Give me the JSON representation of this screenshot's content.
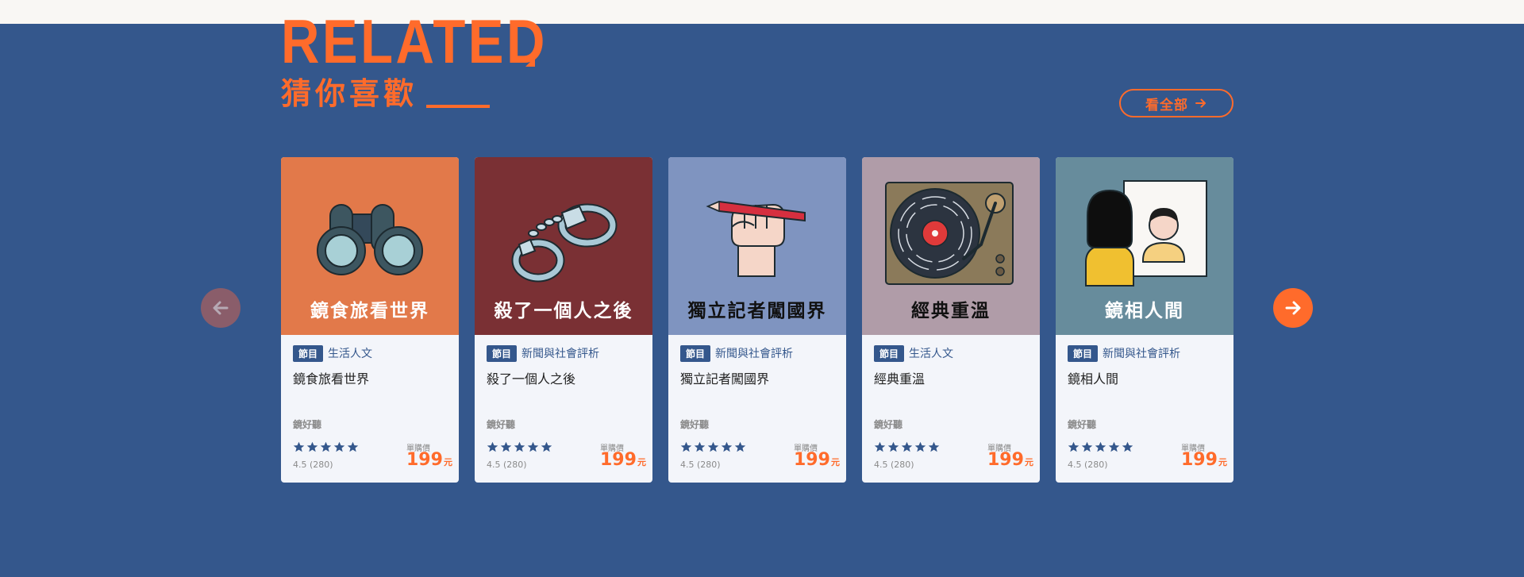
{
  "header": {
    "related": "RELATED",
    "title": "猜你喜歡",
    "see_all": "看全部"
  },
  "nav": {
    "prev_icon": "arrow-left-icon",
    "next_icon": "arrow-right-icon"
  },
  "colors": {
    "background": "#34578c",
    "accent": "#ff6b2b",
    "card_bg": "#f3f5fa"
  },
  "cards": [
    {
      "cover_title": "鏡食旅看世界",
      "cover_color": "#e2794a",
      "illustration": "binoculars",
      "tag": "節目",
      "category": "生活人文",
      "title": "鏡食旅看世界",
      "vendor": "鏡好聽",
      "rating": "4.5 (280)",
      "stars": 5,
      "price_label": "單購價",
      "price": "199",
      "unit": "元"
    },
    {
      "cover_title": "殺了一個人之後",
      "cover_color": "#7a3034",
      "illustration": "handcuffs",
      "tag": "節目",
      "category": "新聞與社會評析",
      "title": "殺了一個人之後",
      "vendor": "鏡好聽",
      "rating": "4.5 (280)",
      "stars": 5,
      "price_label": "單購價",
      "price": "199",
      "unit": "元"
    },
    {
      "cover_title": "獨立記者闖國界",
      "cover_color": "#7f94c0",
      "illustration": "fist-pencil",
      "tag": "節目",
      "category": "新聞與社會評析",
      "title": "獨立記者闖國界",
      "vendor": "鏡好聽",
      "rating": "4.5 (280)",
      "stars": 5,
      "price_label": "單購價",
      "price": "199",
      "unit": "元"
    },
    {
      "cover_title": "經典重溫",
      "cover_color": "#b09ca8",
      "illustration": "turntable",
      "tag": "節目",
      "category": "生活人文",
      "title": "經典重溫",
      "vendor": "鏡好聽",
      "rating": "4.5 (280)",
      "stars": 5,
      "price_label": "單購價",
      "price": "199",
      "unit": "元"
    },
    {
      "cover_title": "鏡相人間",
      "cover_color": "#678c9c",
      "illustration": "mirror-person",
      "tag": "節目",
      "category": "新聞與社會評析",
      "title": "鏡相人間",
      "vendor": "鏡好聽",
      "rating": "4.5 (280)",
      "stars": 5,
      "price_label": "單購價",
      "price": "199",
      "unit": "元"
    }
  ]
}
